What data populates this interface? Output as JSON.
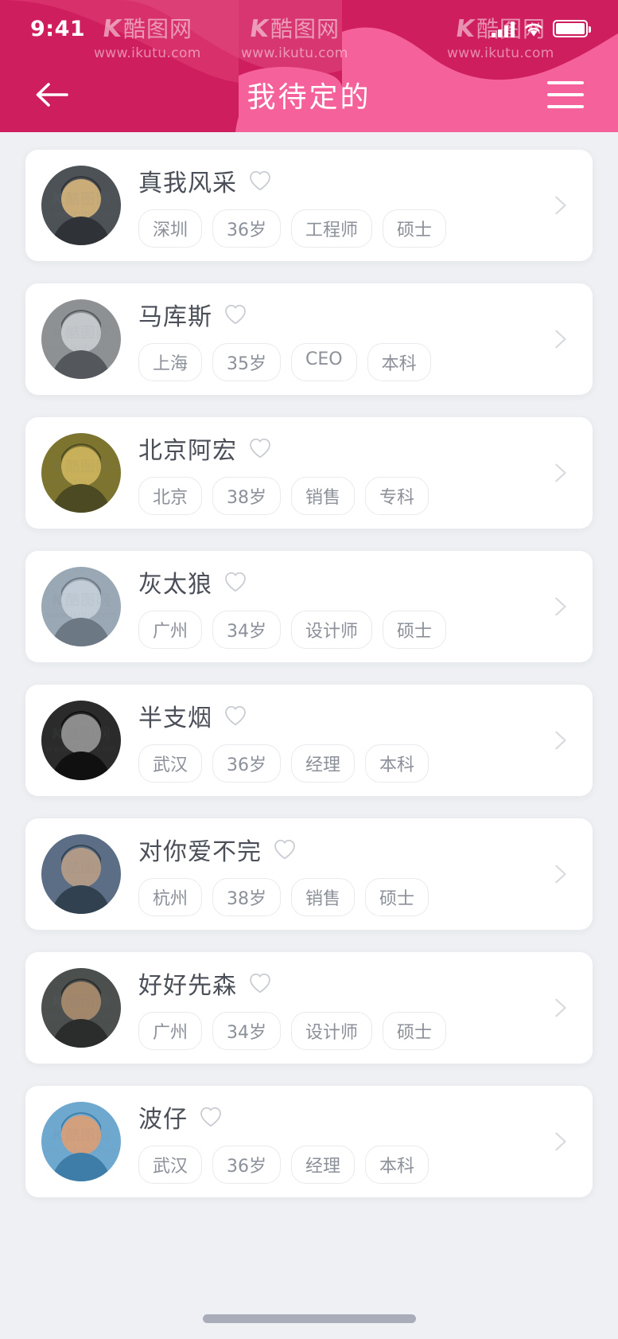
{
  "status_bar": {
    "time": "9:41",
    "signal_icon": "signal-bars-icon",
    "wifi_icon": "wifi-icon",
    "battery_icon": "battery-icon"
  },
  "header": {
    "title": "我待定的",
    "back_icon": "arrow-left-icon",
    "menu_icon": "hamburger-menu-icon",
    "bg_color": "#cf1e5e",
    "wave_color": "#f5619a"
  },
  "watermark": {
    "logo_k": "K",
    "logo_cn": "酷图网",
    "url": "www.ikutu.com"
  },
  "theme": {
    "page_bg": "#eef0f3",
    "card_bg": "#ffffff",
    "name_color": "#4a4f58",
    "tag_color": "#8b9099",
    "tag_border": "#e8eaee",
    "chevron_color": "#d6d9de",
    "heart_color": "#c9ccd2",
    "home_indicator_color": "#a9adb9"
  },
  "icons": {
    "heart": "heart-outline-icon",
    "chevron": "chevron-right-icon"
  },
  "list": [
    {
      "name": "真我风采",
      "tags": [
        "深圳",
        "36岁",
        "工程师",
        "硕士"
      ],
      "avatar_colors": [
        "#4d5257",
        "#2f3337",
        "#c9ac78"
      ]
    },
    {
      "name": "马库斯",
      "tags": [
        "上海",
        "35岁",
        "CEO",
        "本科"
      ],
      "avatar_colors": [
        "#8e9194",
        "#54585c",
        "#c5c8cb"
      ]
    },
    {
      "name": "北京阿宏",
      "tags": [
        "北京",
        "38岁",
        "销售",
        "专科"
      ],
      "avatar_colors": [
        "#7d7430",
        "#4c4a22",
        "#c8b05a"
      ]
    },
    {
      "name": "灰太狼",
      "tags": [
        "广州",
        "34岁",
        "设计师",
        "硕士"
      ],
      "avatar_colors": [
        "#9aa7b4",
        "#6c7884",
        "#c2ccd6"
      ]
    },
    {
      "name": "半支烟",
      "tags": [
        "武汉",
        "36岁",
        "经理",
        "本科"
      ],
      "avatar_colors": [
        "#2b2b2b",
        "#101010",
        "#8d8d8d"
      ]
    },
    {
      "name": "对你爱不完",
      "tags": [
        "杭州",
        "38岁",
        "销售",
        "硕士"
      ],
      "avatar_colors": [
        "#5b6e86",
        "#32414f",
        "#b09a87"
      ]
    },
    {
      "name": "好好先森",
      "tags": [
        "广州",
        "34岁",
        "设计师",
        "硕士"
      ],
      "avatar_colors": [
        "#4b4f4e",
        "#2a2d2c",
        "#a3876b"
      ]
    },
    {
      "name": "波仔",
      "tags": [
        "武汉",
        "36岁",
        "经理",
        "本科"
      ],
      "avatar_colors": [
        "#6fa8cf",
        "#3d7da8",
        "#d3a07e"
      ]
    }
  ]
}
